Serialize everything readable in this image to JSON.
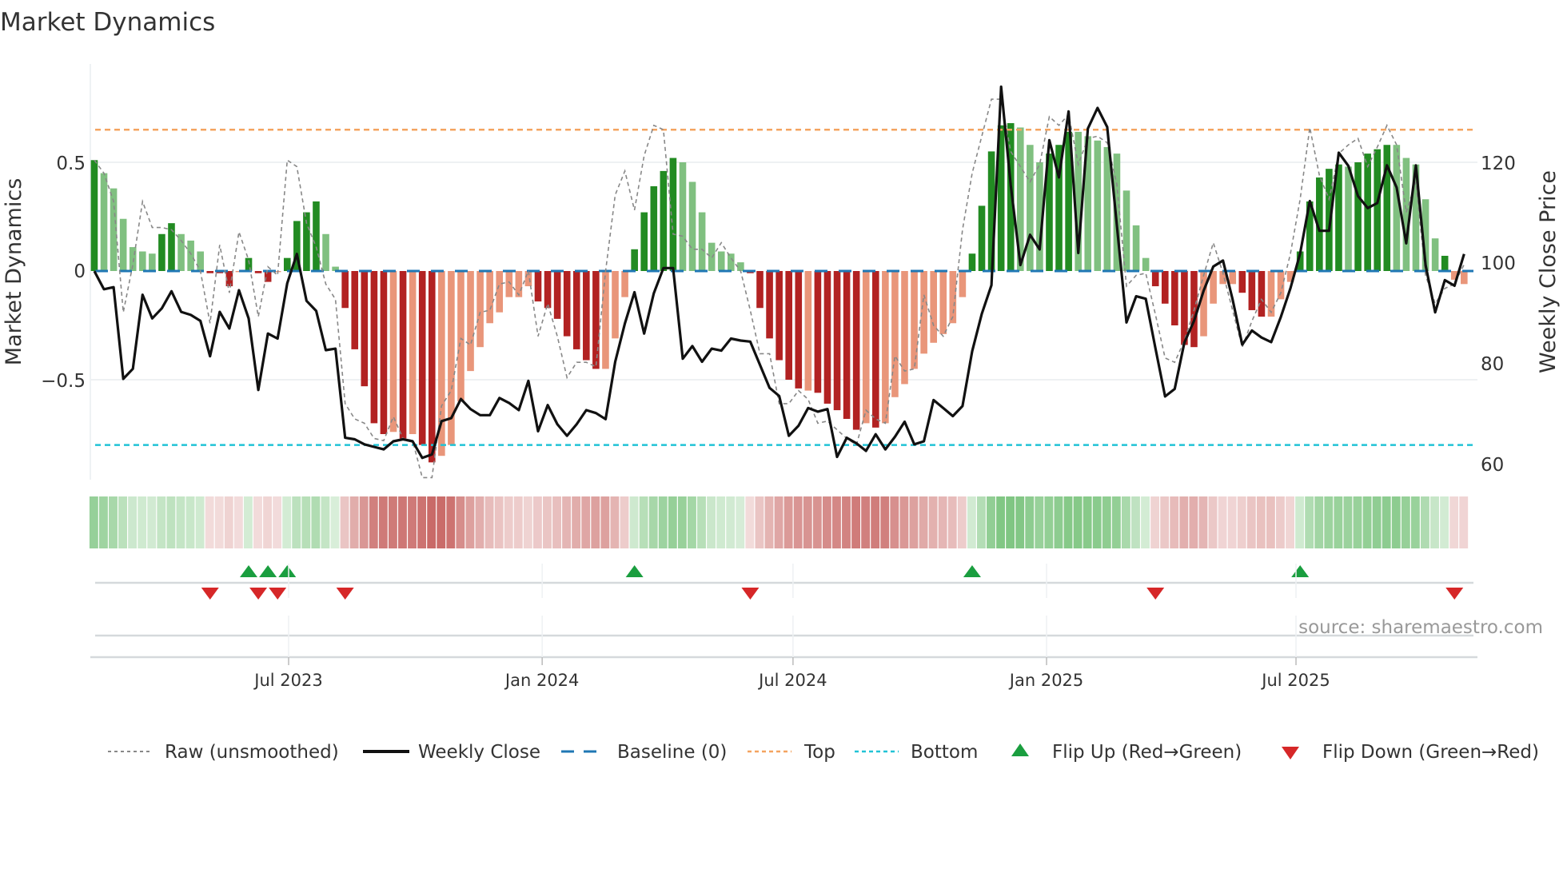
{
  "title": "Market Dynamics",
  "source": "source: sharemaestro.com",
  "colors": {
    "strong_green": "#228b22",
    "weak_green": "#80c080",
    "strong_red": "#b22222",
    "weak_red": "#e9967a",
    "raw": "#888888",
    "close": "#111111",
    "baseline": "#1f77b4",
    "top": "#f4a460",
    "bottom": "#22c3d6",
    "flip_up": "#1a9e3f",
    "flip_down": "#d62728",
    "heat_green": "#4caf50",
    "heat_red": "#c0504d"
  },
  "chart_data": {
    "type": "bar",
    "title": "Market Dynamics",
    "ylabel": "Market Dynamics",
    "ylabel_right": "Weekly Close Price",
    "ylim": [
      -0.96,
      0.95
    ],
    "ylim_right": [
      57,
      139
    ],
    "yticks": [
      {
        "value": 0.5,
        "label": "0.5"
      },
      {
        "value": 0,
        "label": "0"
      },
      {
        "value": -0.5,
        "label": "−0.5"
      }
    ],
    "yticks_right": [
      {
        "value": 120,
        "label": "120"
      },
      {
        "value": 100,
        "label": "100"
      },
      {
        "value": 80,
        "label": "80"
      },
      {
        "value": 60,
        "label": "60"
      }
    ],
    "xticks": [
      {
        "date": "2023-07-01",
        "label": "Jul 2023"
      },
      {
        "date": "2024-01-01",
        "label": "Jan 2024"
      },
      {
        "date": "2024-07-01",
        "label": "Jul 2024"
      },
      {
        "date": "2025-01-01",
        "label": "Jan 2025"
      },
      {
        "date": "2025-07-01",
        "label": "Jul 2025"
      }
    ],
    "start_date": "2023-02-10",
    "frequency": "weekly",
    "grid": true,
    "legend_position": "bottom",
    "top_level": 0.65,
    "bottom_level": -0.8,
    "baseline": 0,
    "dynamics": [
      0.51,
      0.45,
      0.38,
      0.24,
      0.11,
      0.09,
      0.08,
      0.17,
      0.22,
      0.17,
      0.14,
      0.09,
      -0.01,
      -0.01,
      -0.07,
      -0.005,
      0.06,
      -0.01,
      -0.05,
      -0.005,
      0.06,
      0.23,
      0.27,
      0.32,
      0.17,
      0.02,
      -0.17,
      -0.36,
      -0.53,
      -0.7,
      -0.75,
      -0.74,
      -0.77,
      -0.75,
      -0.8,
      -0.88,
      -0.85,
      -0.8,
      -0.6,
      -0.46,
      -0.35,
      -0.24,
      -0.19,
      -0.12,
      -0.12,
      -0.07,
      -0.14,
      -0.17,
      -0.22,
      -0.3,
      -0.36,
      -0.41,
      -0.45,
      -0.45,
      -0.31,
      -0.12,
      0.1,
      0.27,
      0.39,
      0.46,
      0.52,
      0.5,
      0.41,
      0.27,
      0.13,
      0.09,
      0.08,
      0.04,
      -0.01,
      -0.17,
      -0.31,
      -0.41,
      -0.5,
      -0.54,
      -0.55,
      -0.56,
      -0.61,
      -0.64,
      -0.68,
      -0.73,
      -0.7,
      -0.72,
      -0.7,
      -0.58,
      -0.52,
      -0.45,
      -0.38,
      -0.33,
      -0.29,
      -0.24,
      -0.12,
      0.08,
      0.3,
      0.55,
      0.67,
      0.68,
      0.66,
      0.58,
      0.5,
      0.54,
      0.58,
      0.64,
      0.64,
      0.62,
      0.6,
      0.57,
      0.54,
      0.37,
      0.21,
      0.06,
      -0.07,
      -0.15,
      -0.25,
      -0.34,
      -0.35,
      -0.3,
      -0.15,
      -0.06,
      -0.06,
      -0.1,
      -0.18,
      -0.21,
      -0.21,
      -0.13,
      -0.05,
      0.09,
      0.32,
      0.43,
      0.47,
      0.49,
      0.48,
      0.5,
      0.54,
      0.56,
      0.58,
      0.58,
      0.52,
      0.49,
      0.33,
      0.15,
      0.07,
      -0.04,
      -0.06
    ],
    "dynamics_shade": "DLLLLLLDDLLLDDDLDDDLDDDDLLDDDDDLDLDDLLLLLLLLLLDDDDDDDLLLDDDDDLLLLLLLDDDDDDLDDDDDLDLLLLLLLLLDDDDDLLLDDDLLLLLLLLDDDDDLLLLDDDLLLDDDDDLDDDDLLLLLDL",
    "raw": [
      0.51,
      0.45,
      0.32,
      -0.19,
      0.03,
      0.32,
      0.2,
      0.2,
      0.19,
      0.14,
      0.08,
      0.0,
      -0.24,
      0.12,
      -0.1,
      0.18,
      0.05,
      -0.21,
      0.02,
      -0.02,
      0.51,
      0.48,
      0.22,
      0.11,
      -0.06,
      -0.13,
      -0.61,
      -0.68,
      -0.7,
      -0.77,
      -0.78,
      -0.67,
      -0.77,
      -0.78,
      -0.95,
      -0.95,
      -0.62,
      -0.55,
      -0.31,
      -0.34,
      -0.19,
      -0.18,
      -0.06,
      -0.05,
      -0.11,
      0.0,
      -0.3,
      -0.15,
      -0.3,
      -0.49,
      -0.42,
      -0.42,
      -0.44,
      0.0,
      0.35,
      0.46,
      0.28,
      0.53,
      0.67,
      0.65,
      0.17,
      0.16,
      0.1,
      0.1,
      0.06,
      0.13,
      0.06,
      0.0,
      -0.18,
      -0.38,
      -0.38,
      -0.61,
      -0.61,
      -0.55,
      -0.59,
      -0.7,
      -0.69,
      -0.73,
      -0.77,
      -0.8,
      -0.64,
      -0.68,
      -0.7,
      -0.39,
      -0.46,
      -0.45,
      -0.11,
      -0.25,
      -0.3,
      -0.21,
      0.19,
      0.45,
      0.62,
      0.79,
      0.79,
      0.55,
      0.48,
      0.41,
      0.49,
      0.71,
      0.67,
      0.72,
      0.49,
      0.61,
      0.62,
      0.59,
      0.4,
      -0.07,
      -0.02,
      -0.01,
      -0.2,
      -0.4,
      -0.42,
      -0.32,
      -0.18,
      -0.02,
      0.13,
      -0.01,
      -0.18,
      -0.35,
      -0.23,
      -0.13,
      -0.19,
      -0.1,
      0.08,
      0.33,
      0.66,
      0.44,
      0.33,
      0.54,
      0.58,
      0.61,
      0.48,
      0.57,
      0.67,
      0.58,
      0.27,
      0.41,
      -0.02,
      -0.15,
      -0.08,
      -0.06,
      0.03
    ],
    "close": [
      98.4,
      94.8,
      95.2,
      77,
      79,
      93.7,
      89,
      91,
      94.4,
      90.3,
      89.7,
      88.5,
      81.5,
      90.3,
      87,
      94.6,
      89,
      74.8,
      86,
      85,
      96,
      101.8,
      92.5,
      90.5,
      82.7,
      83,
      65.3,
      65,
      64,
      63.5,
      63,
      64.6,
      65,
      64.6,
      61.3,
      62,
      68.6,
      69.2,
      73,
      71,
      69.8,
      69.8,
      73.2,
      72.2,
      70.8,
      76.6,
      66.6,
      71.8,
      68,
      65.7,
      68,
      70.8,
      70.2,
      69,
      80.4,
      88,
      94.2,
      86,
      94,
      99,
      99,
      81,
      83.5,
      80.4,
      83,
      82.6,
      85,
      84.6,
      84.4,
      79.8,
      75.2,
      73.6,
      65.7,
      67.7,
      71.2,
      70.5,
      71,
      61.5,
      65.3,
      64.2,
      62.7,
      66,
      63,
      65.5,
      68.5,
      64,
      64.6,
      72.8,
      71.2,
      69.6,
      71.6,
      82.5,
      89.9,
      95.6,
      135,
      115.5,
      99.6,
      105.6,
      102.7,
      124.4,
      117,
      130.1,
      102,
      126.7,
      130.8,
      127,
      107.6,
      88.2,
      93.4,
      92.9,
      83.1,
      73.5,
      75,
      84.2,
      88.5,
      94.5,
      99.3,
      100.5,
      92.8,
      83.8,
      86.6,
      85.2,
      84.3,
      89.3,
      95,
      101.9,
      112.3,
      106.4,
      106.4,
      121.9,
      119.3,
      113.3,
      110.9,
      111.9,
      119.4,
      115,
      103.9,
      119.4,
      99.6,
      90.2,
      96.6,
      95.5,
      101.8
    ],
    "flip_up_weeks": [
      16,
      18,
      20,
      56,
      91,
      125
    ],
    "flip_down_weeks": [
      12,
      17,
      19,
      26,
      68,
      110,
      141
    ]
  },
  "legend": {
    "raw": "Raw (unsmoothed)",
    "close": "Weekly Close",
    "baseline": "Baseline (0)",
    "top": "Top",
    "bottom": "Bottom",
    "flip_up": "Flip Up (Red→Green)",
    "flip_down": "Flip Down (Green→Red)"
  }
}
